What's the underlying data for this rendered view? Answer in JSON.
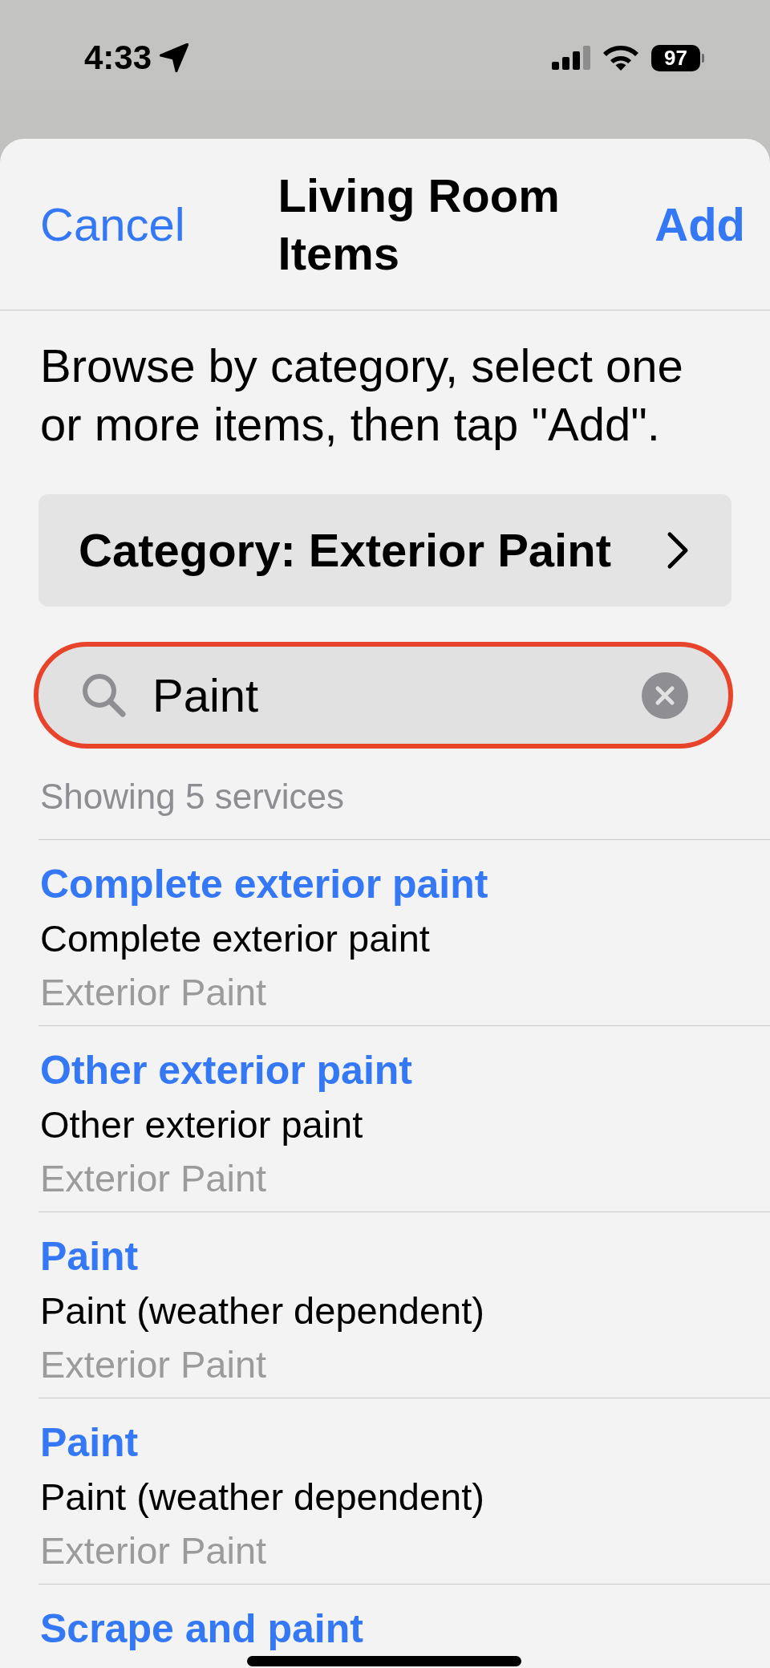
{
  "status_bar": {
    "time": "4:33",
    "battery": "97"
  },
  "header": {
    "cancel": "Cancel",
    "title": "Living Room Items",
    "add": "Add"
  },
  "instructions": "Browse by category, select one or more items, then tap \"Add\".",
  "category_button": {
    "label": "Category: Exterior Paint"
  },
  "search": {
    "value": "Paint"
  },
  "result_count": "Showing 5 services",
  "services": [
    {
      "name": "Complete exterior paint",
      "description": "Complete exterior paint",
      "category": "Exterior Paint"
    },
    {
      "name": "Other exterior paint",
      "description": "Other exterior paint",
      "category": "Exterior Paint"
    },
    {
      "name": "Paint",
      "description": "Paint (weather dependent)",
      "category": "Exterior Paint"
    },
    {
      "name": "Paint",
      "description": "Paint (weather dependent)",
      "category": "Exterior Paint"
    },
    {
      "name": "Scrape and paint"
    }
  ]
}
